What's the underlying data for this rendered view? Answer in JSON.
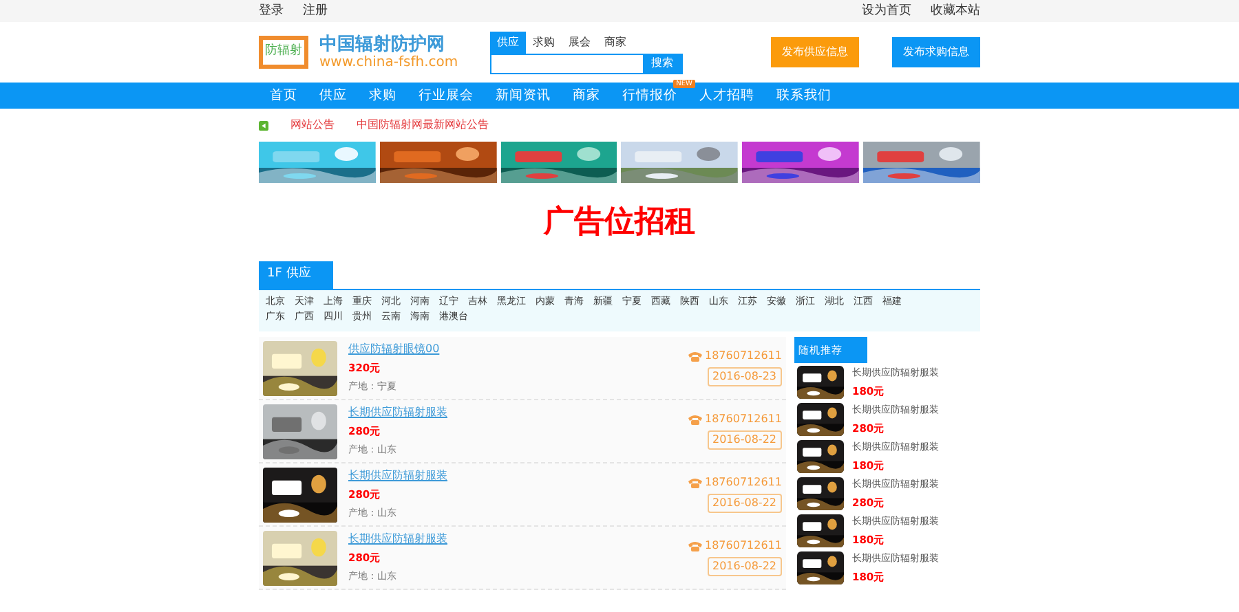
{
  "top_bar": {
    "left_links": [
      "登录",
      "注册"
    ],
    "right_links": [
      "设为首页",
      "收藏本站"
    ]
  },
  "logo": {
    "mark": "防辐射",
    "title": "中国辐射防护网",
    "url": "www.china-fsfh.com"
  },
  "search": {
    "tabs": [
      {
        "label": "供应",
        "selected": true
      },
      {
        "label": "求购",
        "selected": false
      },
      {
        "label": "展会",
        "selected": false
      },
      {
        "label": "商家",
        "selected": false
      }
    ],
    "button": "搜索"
  },
  "header_buttons": [
    {
      "label": "发布供应信息",
      "kind": "orange"
    },
    {
      "label": "发布求购信息",
      "kind": "blue"
    }
  ],
  "nav": [
    {
      "label": "首页"
    },
    {
      "label": "供应"
    },
    {
      "label": "求购"
    },
    {
      "label": "行业展会"
    },
    {
      "label": "新闻资讯"
    },
    {
      "label": "商家"
    },
    {
      "label": "行情报价",
      "badge": "NEW"
    },
    {
      "label": "人才招聘"
    },
    {
      "label": "联系我们"
    }
  ],
  "notice": {
    "label": "网站公告",
    "text": "中国防辐射网最新网站公告"
  },
  "ad_text": "广告位招租",
  "floor": {
    "tab": "1F 供应",
    "regions": [
      [
        "北京",
        "天津",
        "上海",
        "重庆",
        "河北",
        "河南",
        "辽宁",
        "吉林",
        "黑龙江",
        "内蒙",
        "青海",
        "新疆",
        "宁夏",
        "西藏",
        "陕西",
        "山东",
        "江苏",
        "安徽",
        "浙江",
        "湖北",
        "江西",
        "福建"
      ],
      [
        "广东",
        "广西",
        "四川",
        "贵州",
        "云南",
        "海南",
        "港澳台"
      ]
    ],
    "products": [
      {
        "title": "供应防辐射眼镜00",
        "price": "320元",
        "origin": "产地：宁夏",
        "phone": "18760712611",
        "date": "2016-08-23"
      },
      {
        "title": "长期供应防辐射服装",
        "price": "280元",
        "origin": "产地：山东",
        "phone": "18760712611",
        "date": "2016-08-22"
      },
      {
        "title": "长期供应防辐射服装",
        "price": "280元",
        "origin": "产地：山东",
        "phone": "18760712611",
        "date": "2016-08-22"
      },
      {
        "title": "长期供应防辐射服装",
        "price": "280元",
        "origin": "产地：山东",
        "phone": "18760712611",
        "date": "2016-08-22"
      }
    ]
  },
  "recommend": {
    "title": "随机推荐",
    "items": [
      {
        "title": "长期供应防辐射服装",
        "price": "180元"
      },
      {
        "title": "长期供应防辐射服装",
        "price": "280元"
      },
      {
        "title": "长期供应防辐射服装",
        "price": "180元"
      },
      {
        "title": "长期供应防辐射服装",
        "price": "280元"
      },
      {
        "title": "长期供应防辐射服装",
        "price": "180元"
      },
      {
        "title": "长期供应防辐射服装",
        "price": "180元"
      }
    ]
  }
}
